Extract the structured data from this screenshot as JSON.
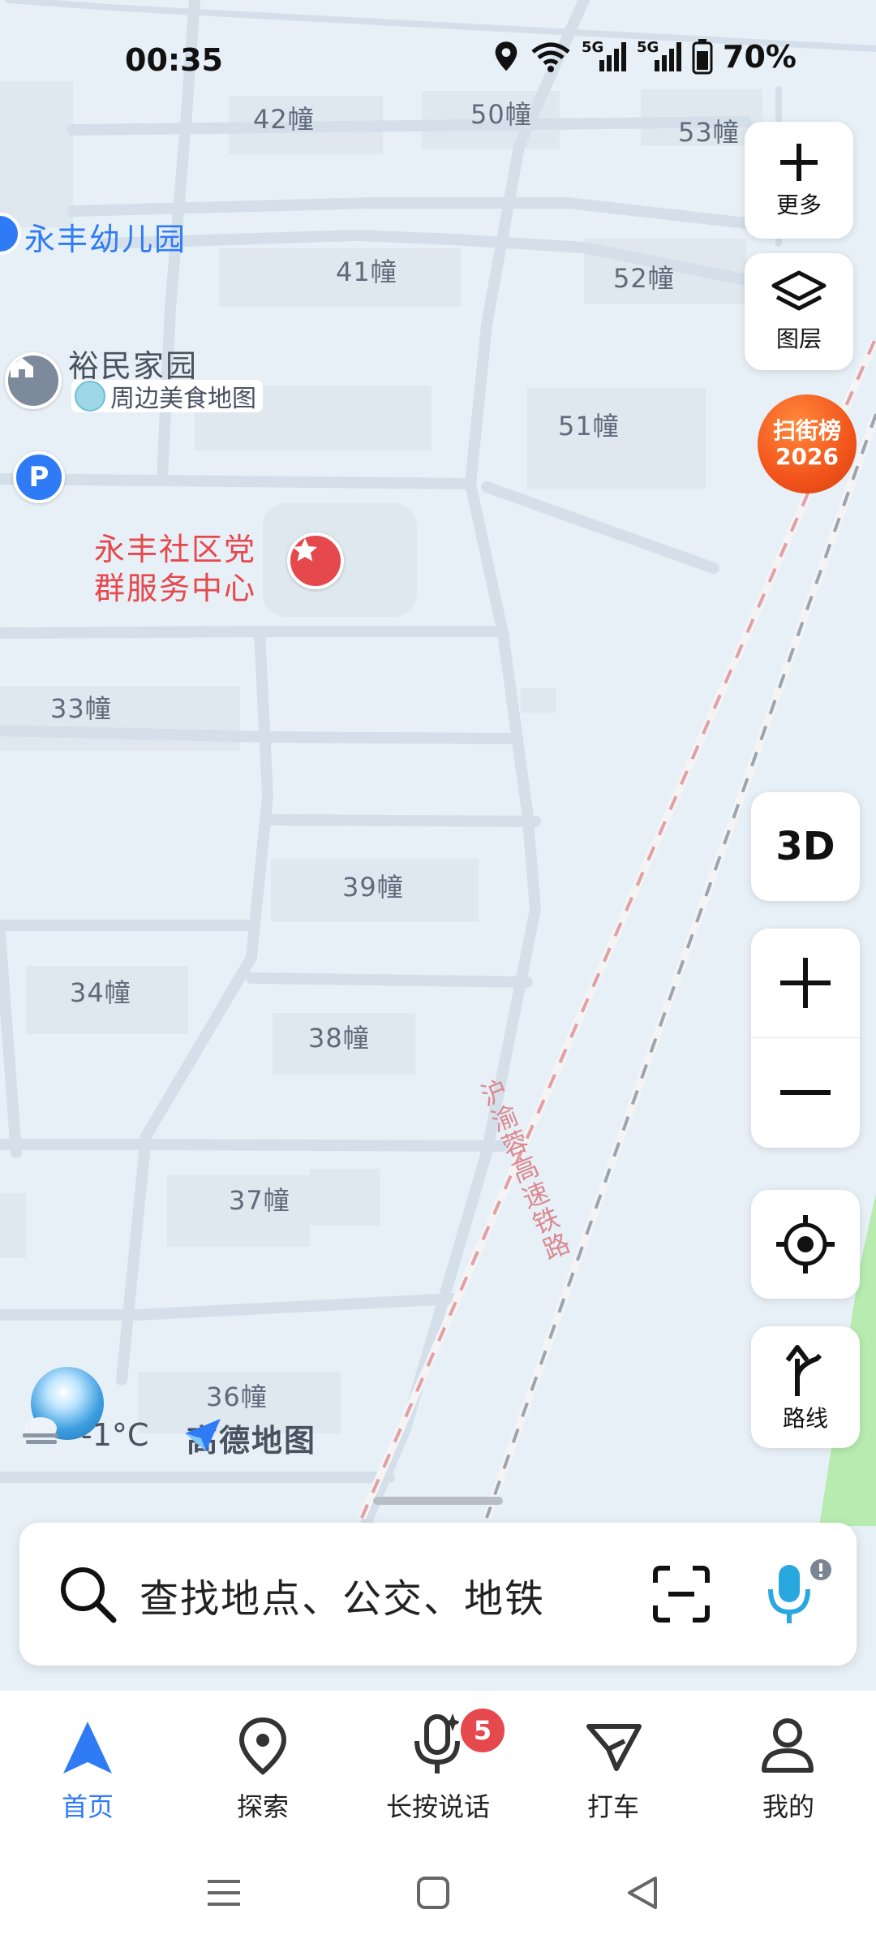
{
  "status": {
    "time": "00:35",
    "battery": "70%",
    "net1": "5G",
    "net2": "5G"
  },
  "map": {
    "buildings": [
      {
        "id": "b42",
        "label": "42幢"
      },
      {
        "id": "b50",
        "label": "50幢"
      },
      {
        "id": "b53",
        "label": "53幢"
      },
      {
        "id": "b41",
        "label": "41幢"
      },
      {
        "id": "b52",
        "label": "52幢"
      },
      {
        "id": "b51",
        "label": "51幢"
      },
      {
        "id": "b33",
        "label": "33幢"
      },
      {
        "id": "b39",
        "label": "39幢"
      },
      {
        "id": "b34",
        "label": "34幢"
      },
      {
        "id": "b38",
        "label": "38幢"
      },
      {
        "id": "b37",
        "label": "37幢"
      },
      {
        "id": "b36",
        "label": "36幢"
      }
    ],
    "pois": {
      "kindergarten": "永丰幼儿园",
      "community": "裕民家园",
      "food_map": "周边美食地图",
      "parking": "P",
      "service_center_line1": "永丰社区党",
      "service_center_line2": "群服务中心"
    },
    "railway": "沪渝蓉高速铁路",
    "weather_temp": "-1°C",
    "brand": "高德地图"
  },
  "controls": {
    "more": "更多",
    "layers": "图层",
    "promo_line1": "扫街榜",
    "promo_line2": "2026",
    "three_d": "3D",
    "route": "路线"
  },
  "search": {
    "placeholder": "查找地点、公交、地铁"
  },
  "nav": {
    "items": [
      {
        "label": "首页"
      },
      {
        "label": "探索"
      },
      {
        "label": "长按说话"
      },
      {
        "label": "打车"
      },
      {
        "label": "我的"
      }
    ],
    "badge": "5"
  },
  "colors": {
    "accent": "#2f7bf5",
    "poi_red": "#e5484d",
    "map_bg": "#e8f0f7"
  }
}
